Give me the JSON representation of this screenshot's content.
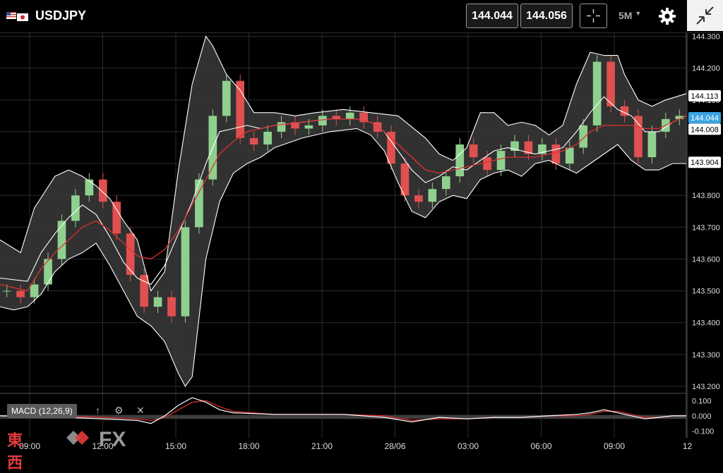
{
  "header": {
    "symbol": "USDJPY",
    "bid": "144.044",
    "ask": "144.056",
    "timeframe": "5M"
  },
  "colors": {
    "background": "#000000",
    "grid": "#2b2b2b",
    "band_fill": "#3a3a3a",
    "band_line": "#ffffff",
    "ma_line": "#e03030",
    "bull_candle": "#8fd08f",
    "bear_candle": "#e05050",
    "current_price_tag": "#3aa3e0",
    "macd_panel": "#3d3d3d"
  },
  "indicator": {
    "macd_label": "MACD (12,26,9)"
  },
  "branding": {
    "kanji": "東西",
    "fx": "FX"
  },
  "chart_data": {
    "type": "line",
    "title": "",
    "x_tick_labels": [
      "09:00",
      "12:00",
      "15:00",
      "18:00",
      "21:00",
      "28/06",
      "03:00",
      "06:00",
      "09:00",
      "12"
    ],
    "y_tick_labels": [
      "144.300",
      "144.200",
      "144.100",
      "144.000",
      "143.900",
      "143.800",
      "143.700",
      "143.600",
      "143.500",
      "143.400",
      "143.300",
      "143.200"
    ],
    "ylim": [
      143.18,
      144.31
    ],
    "x_index_range": [
      0,
      100
    ],
    "price_tags": [
      {
        "label": "144.113",
        "value": 144.113,
        "style": "white"
      },
      {
        "label": "144.044",
        "value": 144.044,
        "style": "current"
      },
      {
        "label": "144.008",
        "value": 144.008,
        "style": "white"
      },
      {
        "label": "143.904",
        "value": 143.904,
        "style": "white"
      }
    ],
    "series": [
      {
        "kind": "bollinger_upper",
        "x": [
          0,
          3,
          5,
          8,
          10,
          12,
          14,
          16,
          18,
          20,
          22,
          24,
          26,
          28,
          30,
          31,
          33,
          35,
          37,
          40,
          43,
          46,
          50,
          54,
          58,
          62,
          64,
          66,
          68,
          70,
          72,
          74,
          76,
          78,
          80,
          82,
          84,
          86,
          88,
          90,
          91,
          93,
          95,
          97,
          100
        ],
        "values": [
          143.66,
          143.62,
          143.76,
          143.86,
          143.88,
          143.86,
          143.83,
          143.79,
          143.72,
          143.66,
          143.5,
          143.56,
          143.88,
          144.15,
          144.3,
          144.27,
          144.18,
          144.13,
          144.06,
          144.06,
          144.05,
          144.06,
          144.07,
          144.06,
          144.05,
          143.98,
          143.93,
          143.91,
          143.95,
          144.06,
          144.06,
          144.02,
          144.03,
          144.02,
          143.99,
          144.02,
          144.15,
          144.25,
          144.24,
          144.24,
          144.18,
          144.1,
          144.08,
          144.1,
          144.12
        ]
      },
      {
        "kind": "bollinger_lower",
        "x": [
          0,
          2,
          4,
          6,
          8,
          10,
          12,
          14,
          16,
          18,
          20,
          22,
          24,
          26,
          27,
          28,
          30,
          32,
          34,
          36,
          38,
          40,
          44,
          48,
          52,
          54,
          56,
          58,
          60,
          62,
          64,
          66,
          68,
          70,
          72,
          74,
          76,
          78,
          80,
          82,
          84,
          86,
          88,
          90,
          92,
          94,
          96,
          98,
          100
        ],
        "values": [
          143.45,
          143.44,
          143.45,
          143.49,
          143.56,
          143.6,
          143.62,
          143.65,
          143.58,
          143.5,
          143.42,
          143.39,
          143.34,
          143.24,
          143.2,
          143.23,
          143.6,
          143.78,
          143.87,
          143.9,
          143.92,
          143.95,
          143.98,
          144.0,
          144.01,
          143.99,
          143.94,
          143.84,
          143.75,
          143.73,
          143.78,
          143.8,
          143.79,
          143.85,
          143.87,
          143.88,
          143.86,
          143.9,
          143.91,
          143.89,
          143.87,
          143.9,
          143.93,
          143.96,
          143.91,
          143.88,
          143.88,
          143.9,
          143.9
        ]
      },
      {
        "kind": "bollinger_middle",
        "x": [
          0,
          4,
          6,
          8,
          10,
          12,
          14,
          16,
          18,
          20,
          22,
          24,
          26,
          28,
          30,
          32,
          34,
          36,
          38,
          40,
          44,
          48,
          52,
          54,
          56,
          58,
          60,
          62,
          64,
          66,
          68,
          70,
          72,
          74,
          76,
          78,
          80,
          82,
          84,
          86,
          88,
          90,
          92,
          94,
          96,
          98,
          100
        ],
        "values": [
          143.54,
          143.53,
          143.62,
          143.68,
          143.73,
          143.77,
          143.74,
          143.67,
          143.59,
          143.54,
          143.52,
          143.58,
          143.68,
          143.78,
          143.9,
          144.0,
          144.01,
          144.02,
          144.01,
          144.02,
          144.03,
          144.04,
          144.04,
          144.03,
          144.0,
          143.94,
          143.88,
          143.84,
          143.86,
          143.89,
          143.88,
          143.91,
          143.94,
          143.95,
          143.94,
          143.93,
          143.94,
          143.95,
          144.0,
          144.06,
          144.11,
          144.07,
          144.05,
          144.0,
          144.0,
          144.03,
          144.05
        ]
      },
      {
        "kind": "moving_average",
        "x": [
          0,
          4,
          6,
          8,
          10,
          12,
          14,
          16,
          18,
          20,
          22,
          24,
          26,
          28,
          30,
          32,
          34,
          36,
          38,
          40,
          44,
          48,
          52,
          54,
          56,
          58,
          60,
          62,
          64,
          66,
          68,
          70,
          72,
          74,
          76,
          78,
          80,
          82,
          84,
          86,
          88,
          90,
          92,
          94,
          96,
          98,
          100
        ],
        "values": [
          143.52,
          143.5,
          143.57,
          143.62,
          143.66,
          143.7,
          143.72,
          143.69,
          143.65,
          143.61,
          143.6,
          143.63,
          143.69,
          143.77,
          143.85,
          143.93,
          143.97,
          144.0,
          144.01,
          144.02,
          144.03,
          144.04,
          144.04,
          144.03,
          144.0,
          143.96,
          143.92,
          143.88,
          143.87,
          143.88,
          143.89,
          143.9,
          143.91,
          143.92,
          143.92,
          143.92,
          143.93,
          143.94,
          143.96,
          144.0,
          144.02,
          144.02,
          144.02,
          144.01,
          144.01,
          144.03,
          144.05
        ]
      }
    ],
    "candles": {
      "close": [
        143.5,
        143.48,
        143.52,
        143.6,
        143.72,
        143.8,
        143.85,
        143.78,
        143.68,
        143.55,
        143.45,
        143.48,
        143.42,
        143.7,
        143.85,
        144.05,
        144.16,
        143.98,
        143.96,
        144.0,
        144.03,
        144.01,
        144.02,
        144.05,
        144.04,
        144.06,
        144.03,
        144.0,
        143.9,
        143.8,
        143.78,
        143.82,
        143.86,
        143.96,
        143.92,
        143.88,
        143.94,
        143.97,
        143.93,
        143.96,
        143.9,
        143.95,
        144.02,
        144.22,
        144.08,
        144.05,
        143.92,
        144.0,
        144.04,
        144.05
      ]
    },
    "macd": {
      "label": "MACD (12,26,9)",
      "y_tick_labels": [
        "0.100",
        "0.000",
        "-0.100"
      ],
      "ylim": [
        -0.14,
        0.13
      ],
      "macd_line": {
        "x": [
          0,
          10,
          20,
          22,
          24,
          26,
          28,
          30,
          32,
          34,
          40,
          50,
          56,
          60,
          64,
          68,
          72,
          76,
          80,
          84,
          86,
          88,
          90,
          92,
          94,
          96,
          98,
          100
        ],
        "values": [
          0.0,
          -0.01,
          -0.03,
          -0.05,
          0.0,
          0.07,
          0.12,
          0.09,
          0.04,
          0.02,
          0.01,
          0.01,
          -0.01,
          -0.04,
          -0.01,
          -0.02,
          -0.01,
          -0.01,
          0.0,
          0.01,
          0.02,
          0.04,
          0.02,
          0.0,
          -0.02,
          -0.01,
          0.0,
          0.0
        ]
      },
      "signal_line": {
        "x": [
          0,
          10,
          20,
          22,
          24,
          26,
          28,
          30,
          32,
          34,
          40,
          50,
          56,
          60,
          64,
          68,
          72,
          76,
          80,
          84,
          86,
          88,
          90,
          92,
          94,
          96,
          98,
          100
        ],
        "values": [
          0.0,
          0.0,
          -0.02,
          -0.03,
          -0.01,
          0.04,
          0.09,
          0.1,
          0.06,
          0.03,
          0.01,
          0.01,
          0.0,
          -0.03,
          -0.02,
          -0.02,
          -0.01,
          -0.01,
          0.0,
          0.0,
          0.01,
          0.03,
          0.03,
          0.01,
          -0.01,
          -0.01,
          0.0,
          0.0
        ]
      }
    }
  }
}
